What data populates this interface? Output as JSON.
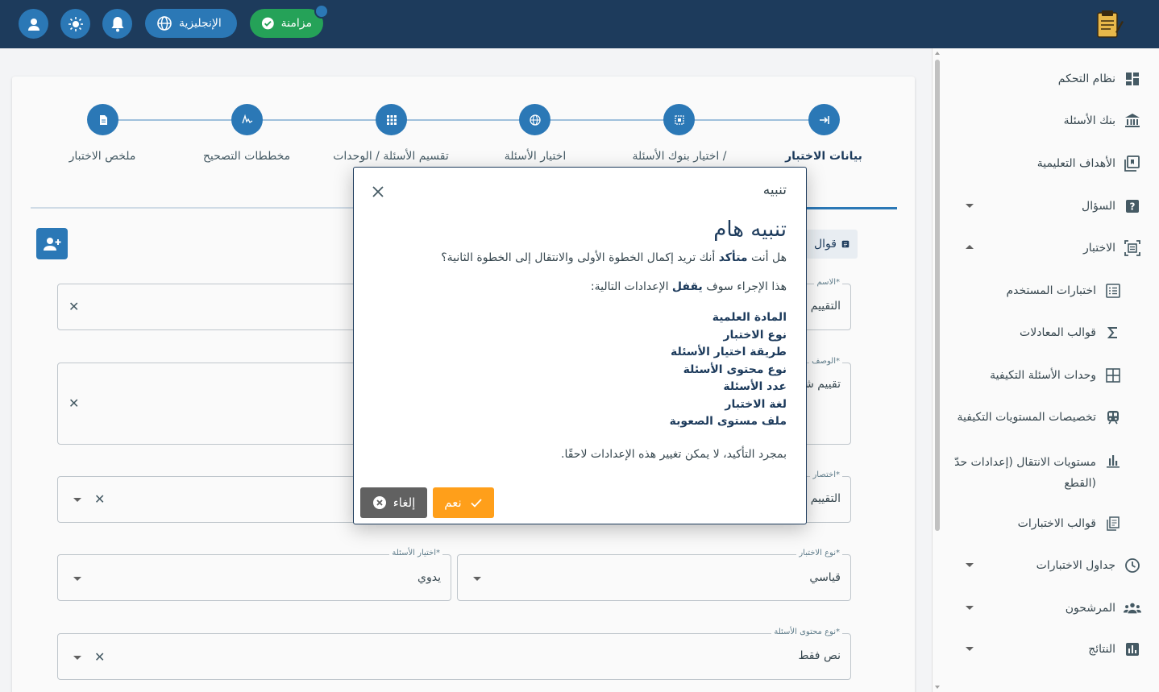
{
  "topbar": {
    "language_label": "الإنجليزية",
    "sync_label": "مزامنة"
  },
  "stepper": {
    "steps": [
      {
        "label": "بيانات الاختبار",
        "icon": "login-arrow-icon",
        "active": true
      },
      {
        "label": "اختيار بنوك الأسئلة /",
        "icon": "bank-select-icon",
        "active": false
      },
      {
        "label": "اختيار الأسئلة",
        "icon": "globe-icon",
        "active": false
      },
      {
        "label": "تقسيم الأسئلة / الوحدات",
        "icon": "grid-icon",
        "active": false
      },
      {
        "label": "مخططات التصحيح",
        "icon": "signature-icon",
        "active": false
      },
      {
        "label": "ملخص الاختبار",
        "icon": "document-icon",
        "active": false
      }
    ]
  },
  "form": {
    "template_button": "قوال",
    "name": {
      "label": "الاسم*",
      "value": "التقييم ا"
    },
    "description": {
      "label": "الوصف*",
      "value": "تقييم شا"
    },
    "short": {
      "label": "اختصار*",
      "value": "التقييم ا"
    },
    "test_type": {
      "label": "نوع الاختبار*",
      "value": "قياسي"
    },
    "question_selection": {
      "label": "اختيار الأسئلة*",
      "value": "يدوي"
    },
    "content_type": {
      "label": "نوع محتوى الأسئلة*",
      "value": "نص فقط"
    }
  },
  "sidebar": {
    "items": [
      {
        "label": "نظام التحكم",
        "icon": "dashboard-icon"
      },
      {
        "label": "بنك الأسئلة",
        "icon": "bank-icon"
      },
      {
        "label": "الأهداف التعليمية",
        "icon": "objectives-icon"
      },
      {
        "label": "السؤال",
        "icon": "question-icon"
      },
      {
        "label": "الاختبار",
        "icon": "exam-icon"
      },
      {
        "label": "اختبارات المستخدم",
        "icon": "user-tests-icon"
      },
      {
        "label": "قوالب المعادلات",
        "icon": "sigma-icon"
      },
      {
        "label": "وحدات الأسئلة التكيفية",
        "icon": "units-grid-icon"
      },
      {
        "label": "تخصيصات المستويات التكيفية",
        "icon": "train-icon"
      },
      {
        "label": "مستويات الانتقال (إعدادات حدّ",
        "label2": "القطع)",
        "icon": "bar-chart-icon"
      },
      {
        "label": "قوالب الاختبارات",
        "icon": "templates-icon"
      },
      {
        "label": "جداول الاختبارات",
        "icon": "clock-icon"
      },
      {
        "label": "المرشحون",
        "icon": "people-icon"
      },
      {
        "label": "النتائج",
        "icon": "results-icon"
      }
    ]
  },
  "dialog": {
    "header": "تنبيه",
    "title": "تنبيه هام",
    "q_prefix": "هل أنت",
    "q_bold": "متأكد",
    "q_suffix": "أنك تريد إكمال الخطوة الأولى والانتقال إلى الخطوة الثانية؟",
    "lock_prefix": "هذا الإجراء سوف",
    "lock_bold": "يقفل",
    "lock_suffix": "الإعدادات التالية:",
    "locked_items": [
      "المادة العلمية",
      "نوع الاختبار",
      "طريقة اختيار الأسئلة",
      "نوع محتوى الأسئلة",
      "عدد الأسئلة",
      "لغة الاختبار",
      "ملف مستوى الصعوبة"
    ],
    "footer_note": "بمجرد التأكيد، لا يمكن تغيير هذه الإعدادات لاحقًا.",
    "yes_label": "نعم",
    "cancel_label": "إلغاء"
  },
  "colors": {
    "topbar": "#1d3b5c",
    "primary": "#2b78b6",
    "sync": "#25a258",
    "confirm": "#ff9f1a",
    "cancel": "#616161"
  }
}
